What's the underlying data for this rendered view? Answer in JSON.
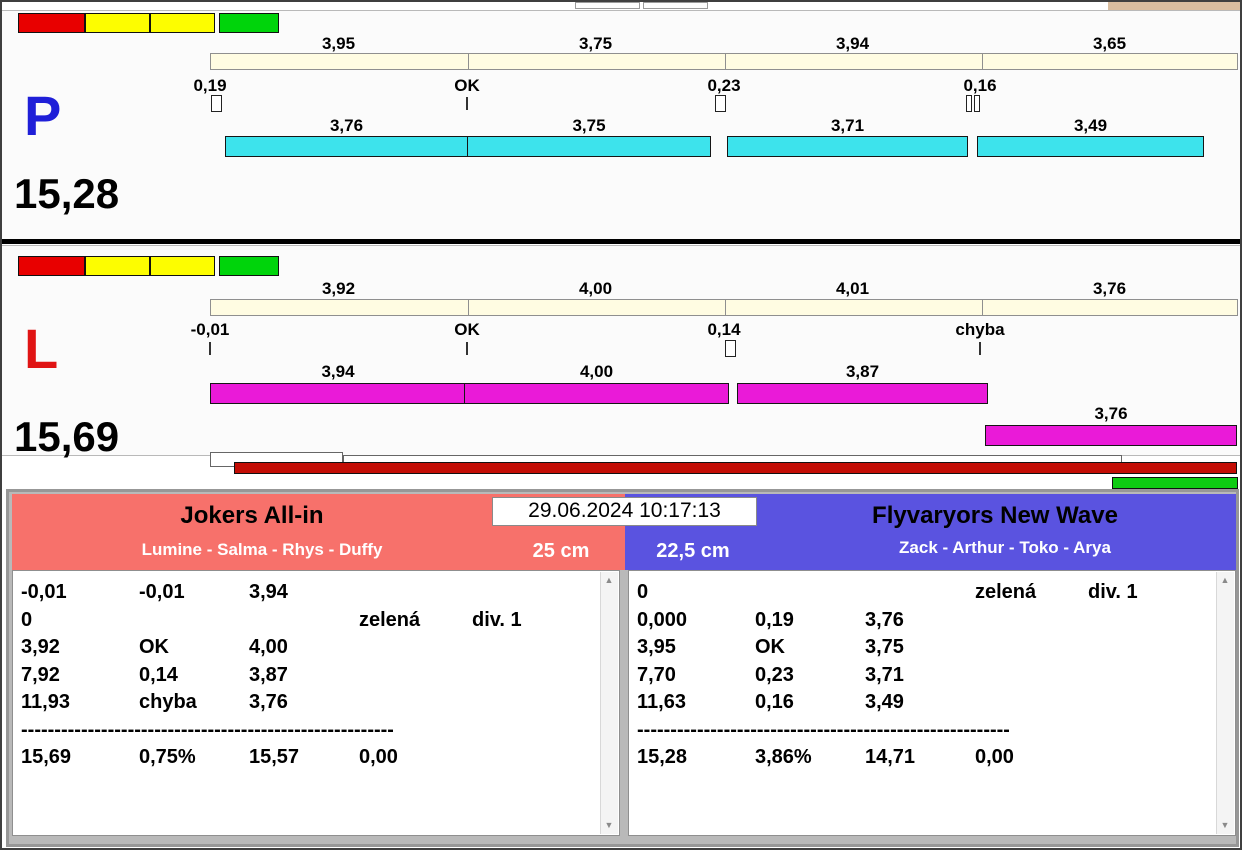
{
  "clock": "29.06.2024 10:17:13",
  "icons": {
    "scroll_up": "▲",
    "scroll_down": "▼"
  },
  "colors": {
    "status_red": "#e80000",
    "status_yellow": "#fdfd00",
    "status_green": "#00d40b",
    "lane_p_letter": "#1f1fd8",
    "lane_l_letter": "#e01414",
    "lane_p_bar": "#3de3ec",
    "lane_l_bar": "#ea1ad8",
    "progress_red": "#c30d05",
    "progress_green": "#0ecb12",
    "team_left_bg": "#f7716b",
    "team_right_bg": "#5a53e0"
  },
  "lanes": [
    {
      "letter": "P",
      "total": "15,28",
      "splits_top": [
        "3,95",
        "3,75",
        "3,94",
        "3,65"
      ],
      "marks": [
        "0,19",
        "OK",
        "0,23",
        "0,16"
      ],
      "splits_bottom": [
        "3,76",
        "3,75",
        "3,71",
        "3,49"
      ]
    },
    {
      "letter": "L",
      "total": "15,69",
      "splits_top": [
        "3,92",
        "4,00",
        "4,01",
        "3,76"
      ],
      "marks": [
        "-0,01",
        "OK",
        "0,14",
        "chyba"
      ],
      "splits_bottom": [
        "3,94",
        "4,00",
        "3,87",
        "3,76"
      ]
    }
  ],
  "teams": [
    {
      "name": "Jokers All-in",
      "members": "Lumine - Salma - Rhys - Duffy",
      "lath_height": "25 cm",
      "rows": [
        [
          "-0,01",
          "-0,01",
          "3,94",
          "",
          ""
        ],
        [
          "0",
          "",
          "",
          "zelená",
          "div. 1"
        ],
        [
          "3,92",
          "OK",
          "4,00",
          "",
          ""
        ],
        [
          "7,92",
          "0,14",
          "3,87",
          "",
          ""
        ],
        [
          "11,93",
          "chyba",
          "3,76",
          "",
          ""
        ]
      ],
      "separator": "------------------------------------------------------------",
      "summary": [
        "15,69",
        "0,75%",
        "15,57",
        "0,00"
      ]
    },
    {
      "name": "Flyvaryors New Wave",
      "members": "Zack - Arthur - Toko - Arya",
      "lath_height": "22,5 cm",
      "rows": [
        [
          "0",
          "",
          "",
          "zelená",
          "div. 1"
        ],
        [
          "0,000",
          "0,19",
          "3,76",
          "",
          ""
        ],
        [
          "3,95",
          "OK",
          "3,75",
          "",
          ""
        ],
        [
          "7,70",
          "0,23",
          "3,71",
          "",
          ""
        ],
        [
          "11,63",
          "0,16",
          "3,49",
          "",
          ""
        ]
      ],
      "separator": "------------------------------------------------------------",
      "summary": [
        "15,28",
        "3,86%",
        "14,71",
        "0,00"
      ]
    }
  ]
}
